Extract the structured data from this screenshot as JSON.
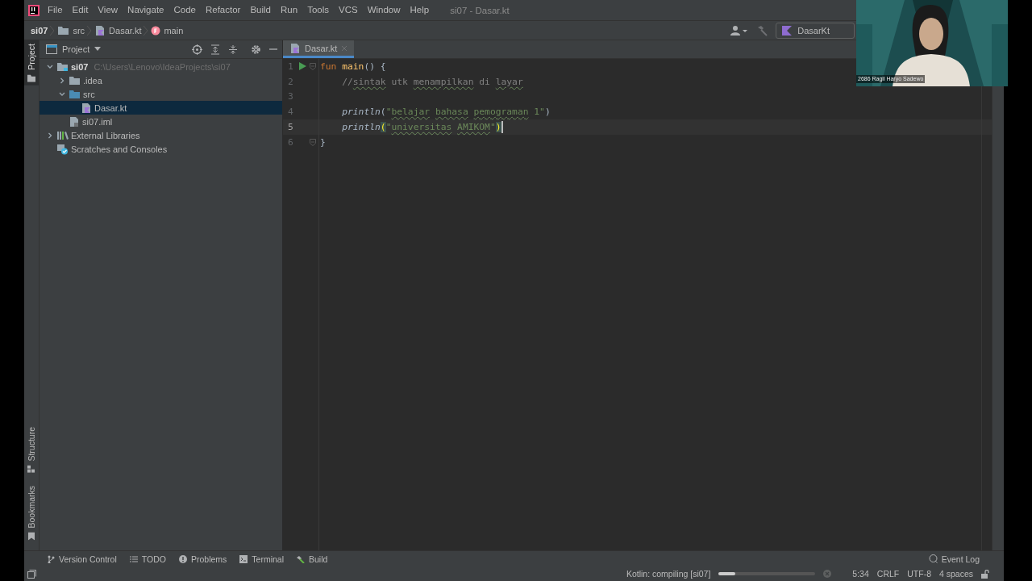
{
  "window": {
    "title": "si07 - Dasar.kt"
  },
  "menu": [
    "File",
    "Edit",
    "View",
    "Navigate",
    "Code",
    "Refactor",
    "Build",
    "Run",
    "Tools",
    "VCS",
    "Window",
    "Help"
  ],
  "breadcrumbs": [
    {
      "label": "si07",
      "kind": "project"
    },
    {
      "label": "src",
      "kind": "folder"
    },
    {
      "label": "Dasar.kt",
      "kind": "kotlin-file"
    },
    {
      "label": "main",
      "kind": "function"
    }
  ],
  "run_config": {
    "label": "DasarKt"
  },
  "side_tabs": {
    "top": [
      {
        "label": "Project",
        "selected": true
      }
    ],
    "bottom": [
      {
        "label": "Structure",
        "selected": false
      },
      {
        "label": "Bookmarks",
        "selected": false
      }
    ]
  },
  "project_panel": {
    "title": "Project",
    "tree": [
      {
        "label": "si07",
        "kind": "module",
        "hint": "C:\\Users\\Lenovo\\IdeaProjects\\si07",
        "expanded": true,
        "selected": false,
        "children": [
          {
            "label": ".idea",
            "kind": "folder",
            "expanded": false,
            "selected": false
          },
          {
            "label": "src",
            "kind": "source-folder",
            "expanded": true,
            "selected": false,
            "children": [
              {
                "label": "Dasar.kt",
                "kind": "kotlin-file",
                "selected": true
              }
            ]
          },
          {
            "label": "si07.iml",
            "kind": "iml-file",
            "selected": false
          }
        ]
      },
      {
        "label": "External Libraries",
        "kind": "libraries",
        "expanded": false,
        "selected": false
      },
      {
        "label": "Scratches and Consoles",
        "kind": "scratches",
        "selected": false
      }
    ]
  },
  "editor": {
    "tabs": [
      {
        "label": "Dasar.kt",
        "selected": true
      }
    ],
    "lines": [
      {
        "number": "1",
        "current": false,
        "run": true,
        "fold": true,
        "caret": false,
        "tokens": [
          {
            "text": "fun ",
            "kind": "keyword"
          },
          {
            "text": "main",
            "kind": "function-name"
          },
          {
            "text": "() {",
            "kind": "plain"
          }
        ]
      },
      {
        "number": "2",
        "current": false,
        "run": false,
        "fold": false,
        "caret": false,
        "tokens": [
          {
            "text": "    //",
            "kind": "comment"
          },
          {
            "text": "sintak",
            "kind": "comment",
            "typo": true
          },
          {
            "text": " utk",
            "kind": "comment"
          },
          {
            "text": " menampilkan",
            "kind": "comment",
            "typo": true
          },
          {
            "text": " di",
            "kind": "comment"
          },
          {
            "text": " layar",
            "kind": "comment",
            "typo": true
          }
        ]
      },
      {
        "number": "3",
        "current": false,
        "run": false,
        "fold": false,
        "caret": false
      },
      {
        "number": "4",
        "current": false,
        "run": false,
        "fold": false,
        "caret": false,
        "tokens": [
          {
            "text": "    println",
            "kind": "call"
          },
          {
            "text": "(",
            "kind": "plain"
          },
          {
            "text": "\"",
            "kind": "string"
          },
          {
            "text": "belajar",
            "kind": "string",
            "typo": true
          },
          {
            "text": " bahasa",
            "kind": "string",
            "typo": true
          },
          {
            "text": " pemograman",
            "kind": "string",
            "typo": true
          },
          {
            "text": " 1\"",
            "kind": "string"
          },
          {
            "text": ")",
            "kind": "plain"
          }
        ]
      },
      {
        "number": "5",
        "current": true,
        "run": false,
        "fold": false,
        "caret": true,
        "tokens": [
          {
            "text": "    println",
            "kind": "call"
          },
          {
            "text": "(",
            "kind": "brace-match"
          },
          {
            "text": "\"",
            "kind": "string"
          },
          {
            "text": "universitas",
            "kind": "string",
            "typo": true
          },
          {
            "text": " AMIKOM",
            "kind": "string",
            "typo": true
          },
          {
            "text": "\"",
            "kind": "string"
          },
          {
            "text": ")",
            "kind": "brace-match"
          }
        ]
      },
      {
        "number": "6",
        "current": false,
        "run": false,
        "fold": true,
        "caret": false,
        "tokens": [
          {
            "text": "}",
            "kind": "plain"
          }
        ]
      }
    ]
  },
  "tool_windows": [
    {
      "label": "Version Control",
      "kind": "vcs"
    },
    {
      "label": "TODO",
      "kind": "todo"
    },
    {
      "label": "Problems",
      "kind": "problems"
    },
    {
      "label": "Terminal",
      "kind": "terminal"
    },
    {
      "label": "Build",
      "kind": "build"
    }
  ],
  "event_log": {
    "label": "Event Log"
  },
  "status_bar": {
    "task": "Kotlin: compiling [si07]",
    "progress": {
      "level": 0.17
    },
    "position": "5:34",
    "line_separator": "CRLF",
    "encoding": "UTF-8",
    "indent": "4 spaces"
  },
  "webcam": {
    "kind": "picture",
    "caption": "2686 Ragil Haryo Sadewo"
  }
}
